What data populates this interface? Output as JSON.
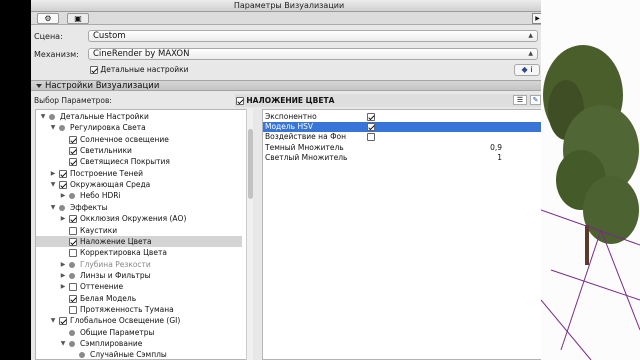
{
  "window": {
    "title": "Параметры Визуализации"
  },
  "scene": {
    "label": "Сцена:",
    "value": "Custom"
  },
  "engine": {
    "label": "Механизм:",
    "value": "CineRender by MAXON"
  },
  "detailed": {
    "label": "Детальные настройки",
    "checked": true
  },
  "section_title": "Настройки Визуализации",
  "params_label": "Выбор Параметров:",
  "color_header": "НАЛОЖЕНИЕ ЦВЕТА",
  "tree": [
    {
      "label": "Детальные Настройки",
      "level": 0,
      "expand": "open",
      "kind": "dot"
    },
    {
      "label": "Регулировка Света",
      "level": 1,
      "expand": "open",
      "kind": "dot"
    },
    {
      "label": "Солнечное освещение",
      "level": 2,
      "expand": "none",
      "kind": "check",
      "checked": true
    },
    {
      "label": "Светильники",
      "level": 2,
      "expand": "none",
      "kind": "check",
      "checked": true
    },
    {
      "label": "Светящиеся Покрытия",
      "level": 2,
      "expand": "none",
      "kind": "check",
      "checked": true
    },
    {
      "label": "Построение Теней",
      "level": 1,
      "expand": "closed",
      "kind": "check",
      "checked": true
    },
    {
      "label": "Окружающая Среда",
      "level": 1,
      "expand": "open",
      "kind": "check",
      "checked": true
    },
    {
      "label": "Небо HDRi",
      "level": 2,
      "expand": "closed",
      "kind": "dot"
    },
    {
      "label": "Эффекты",
      "level": 1,
      "expand": "open",
      "kind": "dot"
    },
    {
      "label": "Окклюзия Окружения (АО)",
      "level": 2,
      "expand": "closed",
      "kind": "check",
      "checked": true
    },
    {
      "label": "Каустики",
      "level": 2,
      "expand": "none",
      "kind": "check",
      "checked": false
    },
    {
      "label": "Наложение Цвета",
      "level": 2,
      "expand": "none",
      "kind": "check",
      "checked": true,
      "selected": true
    },
    {
      "label": "Корректировка Цвета",
      "level": 2,
      "expand": "none",
      "kind": "check",
      "checked": false
    },
    {
      "label": "Глубина Резкости",
      "level": 2,
      "expand": "closed",
      "kind": "dot",
      "dim": true
    },
    {
      "label": "Линзы и Фильтры",
      "level": 2,
      "expand": "closed",
      "kind": "dot"
    },
    {
      "label": "Оттенение",
      "level": 2,
      "expand": "closed",
      "kind": "check",
      "checked": false
    },
    {
      "label": "Белая Модель",
      "level": 2,
      "expand": "none",
      "kind": "check",
      "checked": true
    },
    {
      "label": "Протяженность Тумана",
      "level": 2,
      "expand": "none",
      "kind": "check",
      "checked": false
    },
    {
      "label": "Глобальное Освещение (GI)",
      "level": 1,
      "expand": "open",
      "kind": "check",
      "checked": true
    },
    {
      "label": "Общие Параметры",
      "level": 2,
      "expand": "none",
      "kind": "dot"
    },
    {
      "label": "Сэмплирование",
      "level": 2,
      "expand": "open",
      "kind": "dot"
    },
    {
      "label": "Случайные Сэмплы",
      "level": 3,
      "expand": "none",
      "kind": "dot"
    }
  ],
  "params": [
    {
      "label": "Экспонентно",
      "type": "check",
      "checked": true
    },
    {
      "label": "Модель HSV",
      "type": "check",
      "checked": true,
      "selected": true
    },
    {
      "label": "Воздействие на Фон",
      "type": "check",
      "checked": false
    },
    {
      "label": "Темный Множитель",
      "type": "num",
      "value": "0,9"
    },
    {
      "label": "Светлый Множитель",
      "type": "num",
      "value": "1"
    }
  ]
}
